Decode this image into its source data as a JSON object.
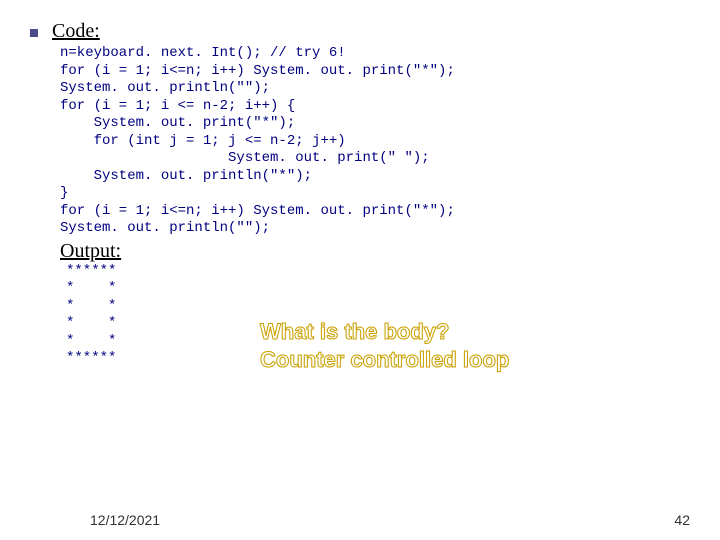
{
  "headings": {
    "code": "Code:",
    "output": "Output:"
  },
  "code": "n=keyboard. next. Int(); // try 6!\nfor (i = 1; i<=n; i++) System. out. print(\"*\");\nSystem. out. println(\"\");\nfor (i = 1; i <= n-2; i++) {\n    System. out. print(\"*\");\n    for (int j = 1; j <= n-2; j++)\n                    System. out. print(\" \");\n    System. out. println(\"*\");\n}\nfor (i = 1; i<=n; i++) System. out. print(\"*\");\nSystem. out. println(\"\");",
  "output": "******\n*    *\n*    *\n*    *\n*    *\n******",
  "callout": "What is the body?\nCounter controlled loop",
  "footer": {
    "date": "12/12/2021",
    "page": "42"
  }
}
